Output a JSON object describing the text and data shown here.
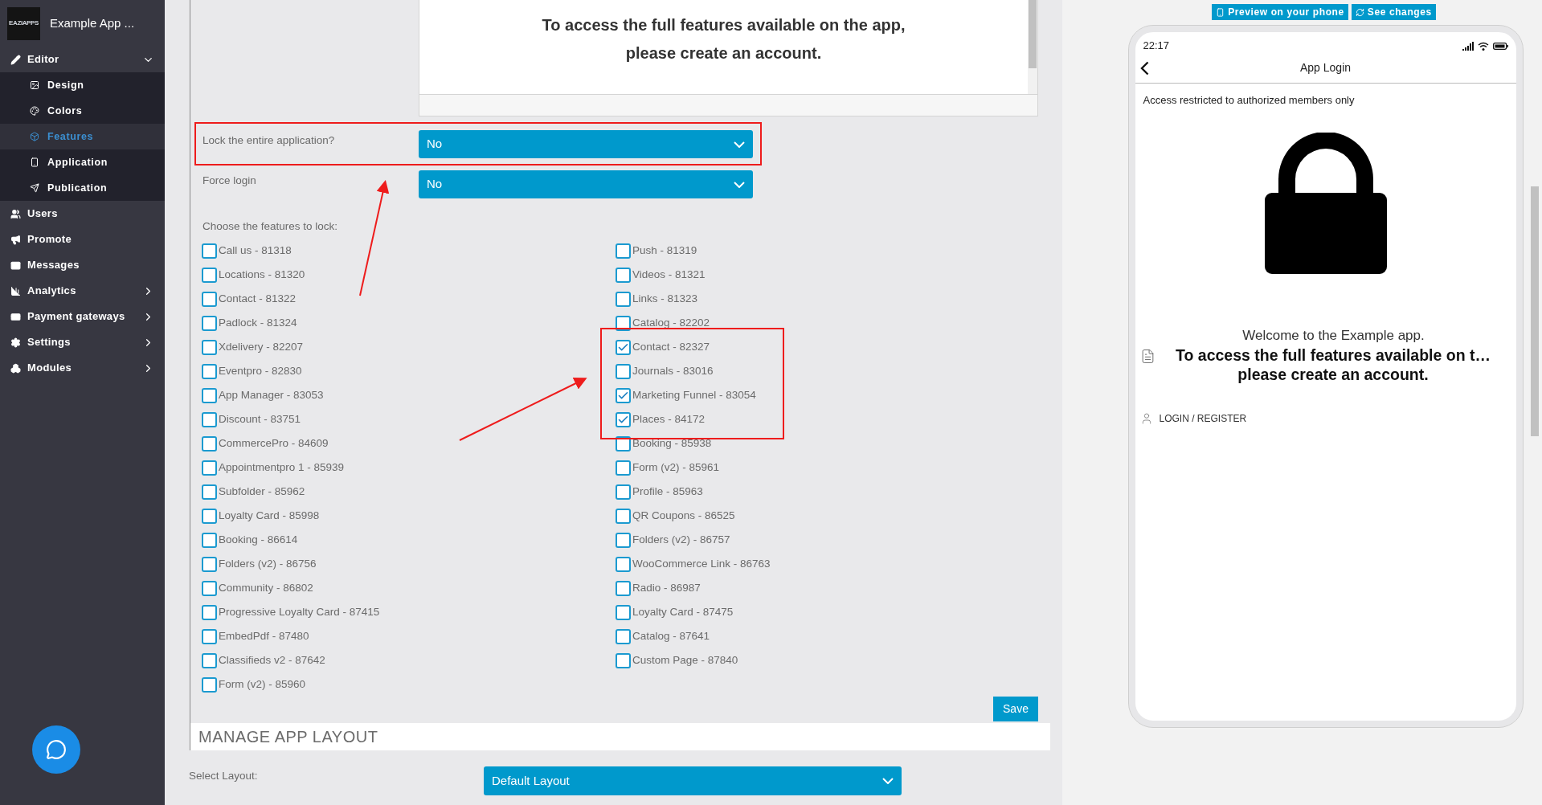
{
  "sidebar": {
    "logo_text": "EAZIAPPS",
    "app_name": "Example App ...",
    "items": [
      {
        "label": "Editor",
        "kind": "group",
        "expanded": true,
        "children": [
          {
            "label": "Design",
            "selected": false
          },
          {
            "label": "Colors",
            "selected": false
          },
          {
            "label": "Features",
            "selected": true
          },
          {
            "label": "Application",
            "selected": false
          },
          {
            "label": "Publication",
            "selected": false
          }
        ]
      },
      {
        "label": "Users",
        "kind": "link"
      },
      {
        "label": "Promote",
        "kind": "link"
      },
      {
        "label": "Messages",
        "kind": "link"
      },
      {
        "label": "Analytics",
        "kind": "group",
        "expanded": false
      },
      {
        "label": "Payment gateways",
        "kind": "group",
        "expanded": false
      },
      {
        "label": "Settings",
        "kind": "group",
        "expanded": false
      },
      {
        "label": "Modules",
        "kind": "group",
        "expanded": false
      }
    ]
  },
  "editor": {
    "lines": [
      "To access the full features available on the app,",
      "please create an account."
    ]
  },
  "lock_app": {
    "label": "Lock the entire application?",
    "value": "No"
  },
  "force_login": {
    "label": "Force login",
    "value": "No"
  },
  "features": {
    "label": "Choose the features to lock:",
    "columns": [
      [
        {
          "label": "Call us - 81318",
          "checked": false
        },
        {
          "label": "Locations - 81320",
          "checked": false
        },
        {
          "label": "Contact - 81322",
          "checked": false
        },
        {
          "label": "Padlock - 81324",
          "checked": false
        },
        {
          "label": "Xdelivery - 82207",
          "checked": false
        },
        {
          "label": "Eventpro - 82830",
          "checked": false
        },
        {
          "label": "App Manager - 83053",
          "checked": false
        },
        {
          "label": "Discount - 83751",
          "checked": false
        },
        {
          "label": "CommercePro - 84609",
          "checked": false
        },
        {
          "label": "Appointmentpro 1 - 85939",
          "checked": false
        },
        {
          "label": "Subfolder - 85962",
          "checked": false
        },
        {
          "label": "Loyalty Card - 85998",
          "checked": false
        },
        {
          "label": "Booking - 86614",
          "checked": false
        },
        {
          "label": "Folders (v2) - 86756",
          "checked": false
        },
        {
          "label": "Community - 86802",
          "checked": false
        },
        {
          "label": "Progressive Loyalty Card - 87415",
          "checked": false
        },
        {
          "label": "EmbedPdf - 87480",
          "checked": false
        },
        {
          "label": "Classifieds v2 - 87642",
          "checked": false
        },
        {
          "label": "Form (v2) - 85960",
          "checked": false
        }
      ],
      [
        {
          "label": "Push - 81319",
          "checked": false
        },
        {
          "label": "Videos - 81321",
          "checked": false
        },
        {
          "label": "Links - 81323",
          "checked": false
        },
        {
          "label": "Catalog - 82202",
          "checked": false
        },
        {
          "label": "Contact - 82327",
          "checked": true
        },
        {
          "label": "Journals - 83016",
          "checked": false
        },
        {
          "label": "Marketing Funnel - 83054",
          "checked": true
        },
        {
          "label": "Places - 84172",
          "checked": true
        },
        {
          "label": "Booking - 85938",
          "checked": false
        },
        {
          "label": "Form (v2) - 85961",
          "checked": false
        },
        {
          "label": "Profile - 85963",
          "checked": false
        },
        {
          "label": "QR Coupons - 86525",
          "checked": false
        },
        {
          "label": "Folders (v2) - 86757",
          "checked": false
        },
        {
          "label": "WooCommerce Link - 86763",
          "checked": false
        },
        {
          "label": "Radio - 86987",
          "checked": false
        },
        {
          "label": "Loyalty Card - 87475",
          "checked": false
        },
        {
          "label": "Catalog - 87641",
          "checked": false
        },
        {
          "label": "Custom Page - 87840",
          "checked": false
        }
      ]
    ]
  },
  "save_button": "Save",
  "layout_section": {
    "title": "MANAGE APP LAYOUT",
    "label": "Select Layout:",
    "value": "Default Layout"
  },
  "preview": {
    "buttons": [
      "Preview on your phone",
      "See changes"
    ],
    "phone": {
      "time": "22:17",
      "title": "App Login",
      "notice": "Access restricted to authorized members only",
      "welcome": "Welcome to the Example app.",
      "message_lines": [
        "To access the full features available on t…",
        "please create an account."
      ],
      "login": "LOGIN / REGISTER"
    }
  }
}
